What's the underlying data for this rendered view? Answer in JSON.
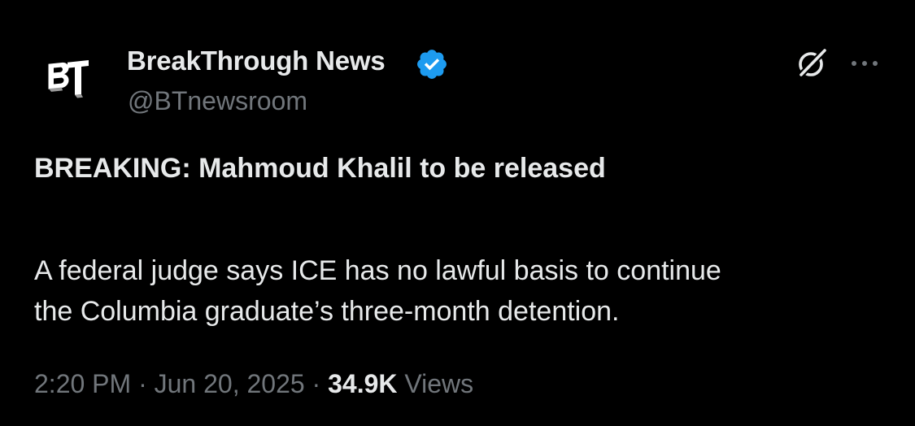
{
  "author": {
    "name": "BreakThrough News",
    "handle": "@BTnewsroom",
    "avatar_icon": "bt-logo-icon",
    "verified_icon": "verified-badge-icon",
    "verified_color": "#1d9bf0"
  },
  "actions": {
    "grok_icon": "grok-icon",
    "more_icon": "more-options-icon"
  },
  "tweet": {
    "headline": "BREAKING: Mahmoud Khalil to be released",
    "body_lines": [
      "A federal judge says ICE has no lawful basis to continue",
      "the Columbia graduate’s three-month detention."
    ]
  },
  "meta": {
    "time": "2:20 PM",
    "separator": "·",
    "date": "Jun 20, 2025",
    "views_count": "34.9K",
    "views_label": "Views"
  },
  "colors": {
    "background": "#000000",
    "primary_text": "#e7e9ea",
    "secondary_text": "#71767b"
  }
}
